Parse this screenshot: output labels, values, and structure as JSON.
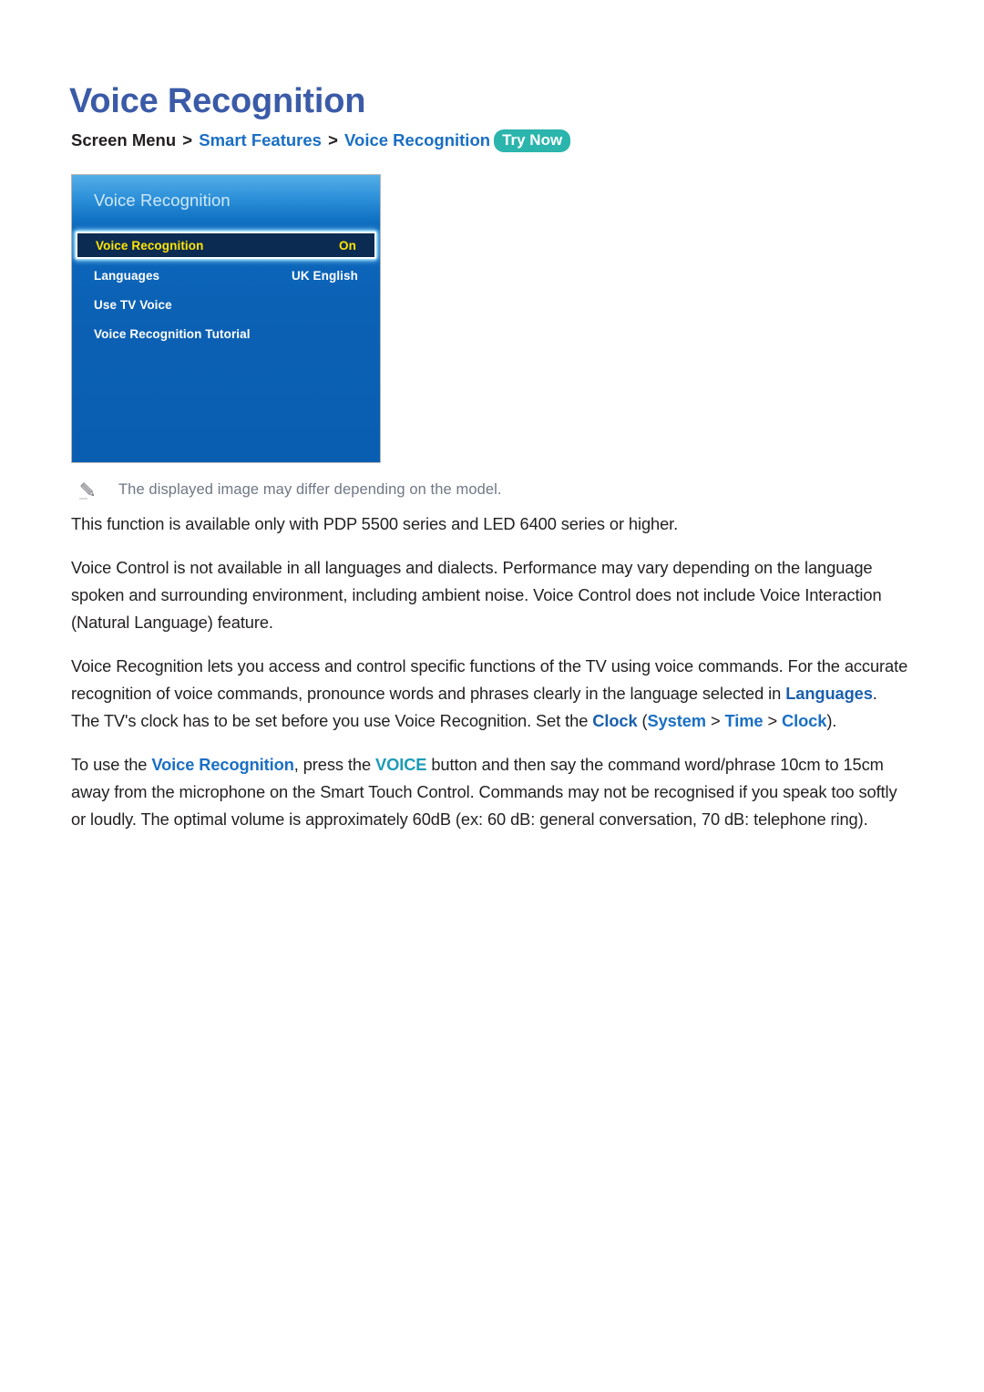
{
  "page_title": "Voice Recognition",
  "breadcrumb": {
    "root": "Screen Menu",
    "sep": ">",
    "level1": "Smart Features",
    "level2": "Voice Recognition",
    "badge": "Try Now"
  },
  "tv_panel": {
    "header_title": "Voice Recognition",
    "rows": [
      {
        "label": "Voice Recognition",
        "value": "On",
        "selected": true
      },
      {
        "label": "Languages",
        "value": "UK English",
        "selected": false
      },
      {
        "label": "Use TV Voice",
        "value": "",
        "selected": false
      },
      {
        "label": "Voice Recognition Tutorial",
        "value": "",
        "selected": false
      }
    ]
  },
  "note": {
    "icon": "pencil-icon",
    "text": "The displayed image may differ depending on the model."
  },
  "paragraphs": {
    "p1": "This function is available only with PDP 5500 series and LED 6400 series or higher.",
    "p2": "Voice Control is not available in all languages and dialects. Performance may vary depending on the language spoken and surrounding environment, including ambient noise. Voice Control does not include Voice Interaction (Natural Language) feature.",
    "p3_a": "Voice Recognition lets you access and control specific functions of the TV using voice commands. For the accurate recognition of voice commands, pronounce words and phrases clearly in the language selected in ",
    "p3_link1": "Languages",
    "p3_b": ". The TV's clock has to be set before you use Voice Recognition. Set the ",
    "p3_link2": "Clock",
    "p3_c": " (",
    "p3_link3": "System",
    "p3_sep1": " > ",
    "p3_link4": "Time",
    "p3_sep2": " > ",
    "p3_link5": "Clock",
    "p3_d": ").",
    "p4_a": "To use the ",
    "p4_link1": "Voice Recognition",
    "p4_b": ", press the ",
    "p4_link2": "VOICE",
    "p4_c": " button and then say the command word/phrase 10cm to 15cm away from the microphone on the Smart Touch Control. Commands may not be recognised if you speak too softly or loudly. The optimal volume is approximately 60dB (ex: 60 dB: general conversation, 70 dB: telephone ring)."
  },
  "colors": {
    "title": "#3b5ba8",
    "breadcrumb_link": "#1a6fc4",
    "badge_bg": "#2bb5ad",
    "body_link": "#1a5fae",
    "voice_link": "#1b9bb5",
    "note_text": "#6f7784",
    "panel_blue": "#0a62b8",
    "selected_row_bg": "#0c2b52",
    "selected_row_text": "#ffe400"
  }
}
